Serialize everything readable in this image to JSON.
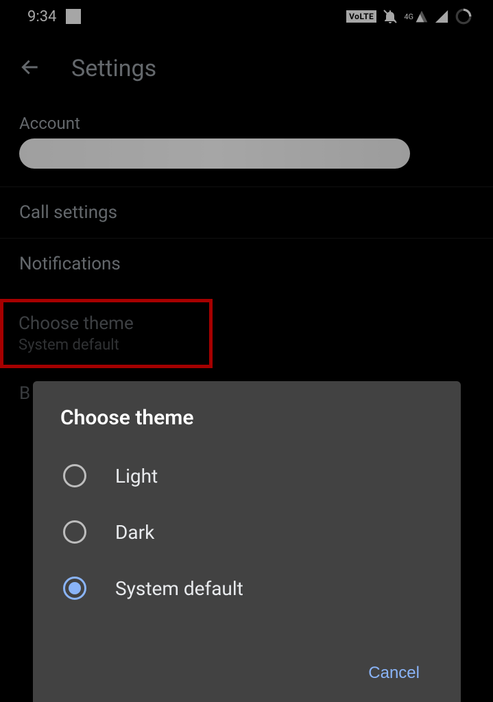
{
  "statusbar": {
    "time": "9:34",
    "volte": "VoLTE",
    "network_label": "4G"
  },
  "header": {
    "title": "Settings"
  },
  "settings": {
    "account_label": "Account",
    "call_settings": "Call settings",
    "notifications": "Notifications",
    "choose_theme": {
      "title": "Choose theme",
      "value": "System default"
    },
    "peek": "B"
  },
  "dialog": {
    "title": "Choose theme",
    "options": [
      {
        "label": "Light",
        "selected": false
      },
      {
        "label": "Dark",
        "selected": false
      },
      {
        "label": "System default",
        "selected": true
      }
    ],
    "cancel": "Cancel"
  }
}
